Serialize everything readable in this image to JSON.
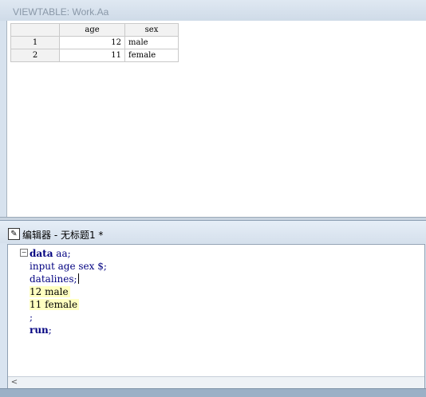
{
  "viewtable": {
    "title": "VIEWTABLE: Work.Aa",
    "columns": [
      "age",
      "sex"
    ],
    "rows": [
      {
        "num": "1",
        "age": "12",
        "sex": "male"
      },
      {
        "num": "2",
        "age": "11",
        "sex": "female"
      }
    ]
  },
  "editor": {
    "title": "编辑器 - 无标题1 *",
    "collapse_glyph": "−",
    "code": {
      "l1_kw": "data",
      "l1_rest": " aa;",
      "l2": "input age sex $;",
      "l3": "datalines;",
      "l4": "12 male",
      "l5": "11 female",
      "l6": ";",
      "l7_kw": "run",
      "l7_rest": ";"
    },
    "scroll_left": "<"
  }
}
